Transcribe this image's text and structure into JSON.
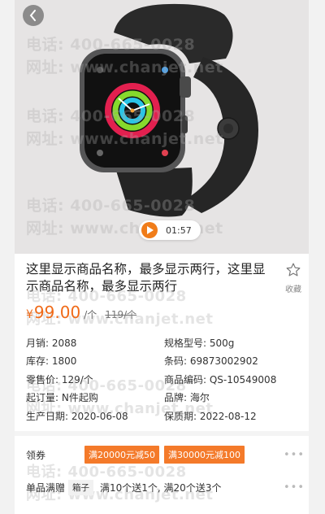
{
  "video": {
    "duration": "01:57"
  },
  "watermark": {
    "phone": "电话: 400-665-0028",
    "site": "网址: www.chanjet.net"
  },
  "product": {
    "title": "这里显示商品名称，最多显示两行，这里显示商品名称，最多显示两行",
    "favorite_label": "收藏",
    "currency": "¥",
    "price": "99.00",
    "unit": "/个",
    "original_price": "119/个"
  },
  "details": [
    [
      "月销: 2088",
      "规格型号: 500g"
    ],
    [
      "库存: 1800",
      "条码: 69873002902"
    ],
    [
      "零售价: 129/个",
      "商品编码: QS-10549008"
    ],
    [
      "起订量: N件起购",
      "品牌: 海尔"
    ],
    [
      "生产日期: 2020-06-08",
      "保质期: 2022-08-12"
    ]
  ],
  "coupons": {
    "label": "领券",
    "items": [
      "满20000元减50",
      "满30000元减100"
    ],
    "more": "•••"
  },
  "gift": {
    "label": "单品满赠",
    "tag": "箱子",
    "text": "满10个送1个, 满20个送3个",
    "more": "•••"
  },
  "colors": {
    "accent": "#f06a18",
    "coupon_bg": "#f47a2a"
  },
  "icons": [
    "back-icon",
    "play-icon",
    "star-icon",
    "more-icon"
  ]
}
